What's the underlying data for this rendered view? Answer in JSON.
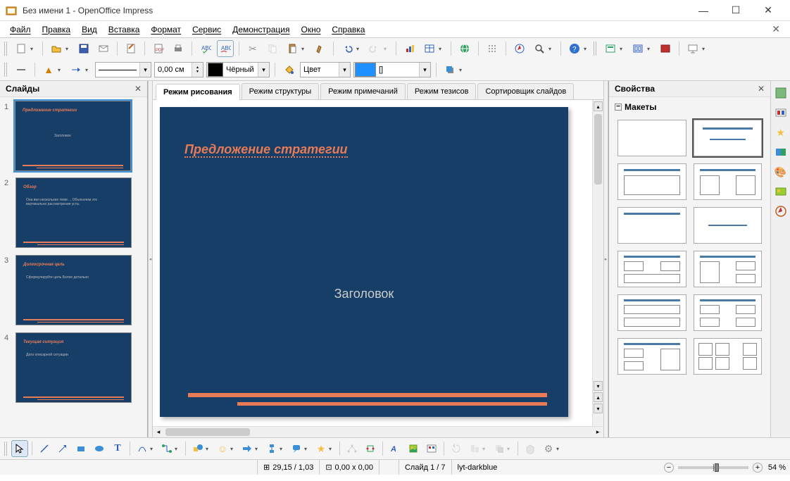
{
  "app": {
    "title": "Без имени 1 - OpenOffice Impress"
  },
  "menu": {
    "file": "Файл",
    "edit": "Правка",
    "view": "Вид",
    "insert": "Вставка",
    "format": "Формат",
    "tools": "Сервис",
    "slideshow": "Демонстрация",
    "window": "Окно",
    "help": "Справка"
  },
  "toolbar2": {
    "line_width": "0,00 см",
    "color_name": "Чёрный",
    "fill_type": "Цвет",
    "fill_swatch_label": "[]"
  },
  "panels": {
    "slides_title": "Слайды",
    "props_title": "Свойства",
    "layouts_title": "Макеты"
  },
  "view_tabs": {
    "drawing": "Режим рисования",
    "outline": "Режим структуры",
    "notes": "Режим примечаний",
    "handout": "Режим тезисов",
    "sorter": "Сортировщик слайдов"
  },
  "slide": {
    "title": "Предложение стратегии",
    "subtitle": "Заголовок"
  },
  "thumbs": [
    {
      "title": "Предложение стратегии",
      "sub": "Заголовок"
    },
    {
      "title": "Обзор",
      "sub": "Она вкл нескольких теми ... Объясняем это вертикально рассмотрения уста."
    },
    {
      "title": "Долгосрочная цель",
      "sub": "Сформулируйте цель Более детально"
    },
    {
      "title": "Текущая ситуация",
      "sub": "Дата описарной ситуации"
    }
  ],
  "status": {
    "pos": "29,15 / 1,03",
    "size": "0,00 x 0,00",
    "slide": "Слайд 1 / 7",
    "template": "lyt-darkblue",
    "zoom": "54 %"
  },
  "chart_data": null
}
